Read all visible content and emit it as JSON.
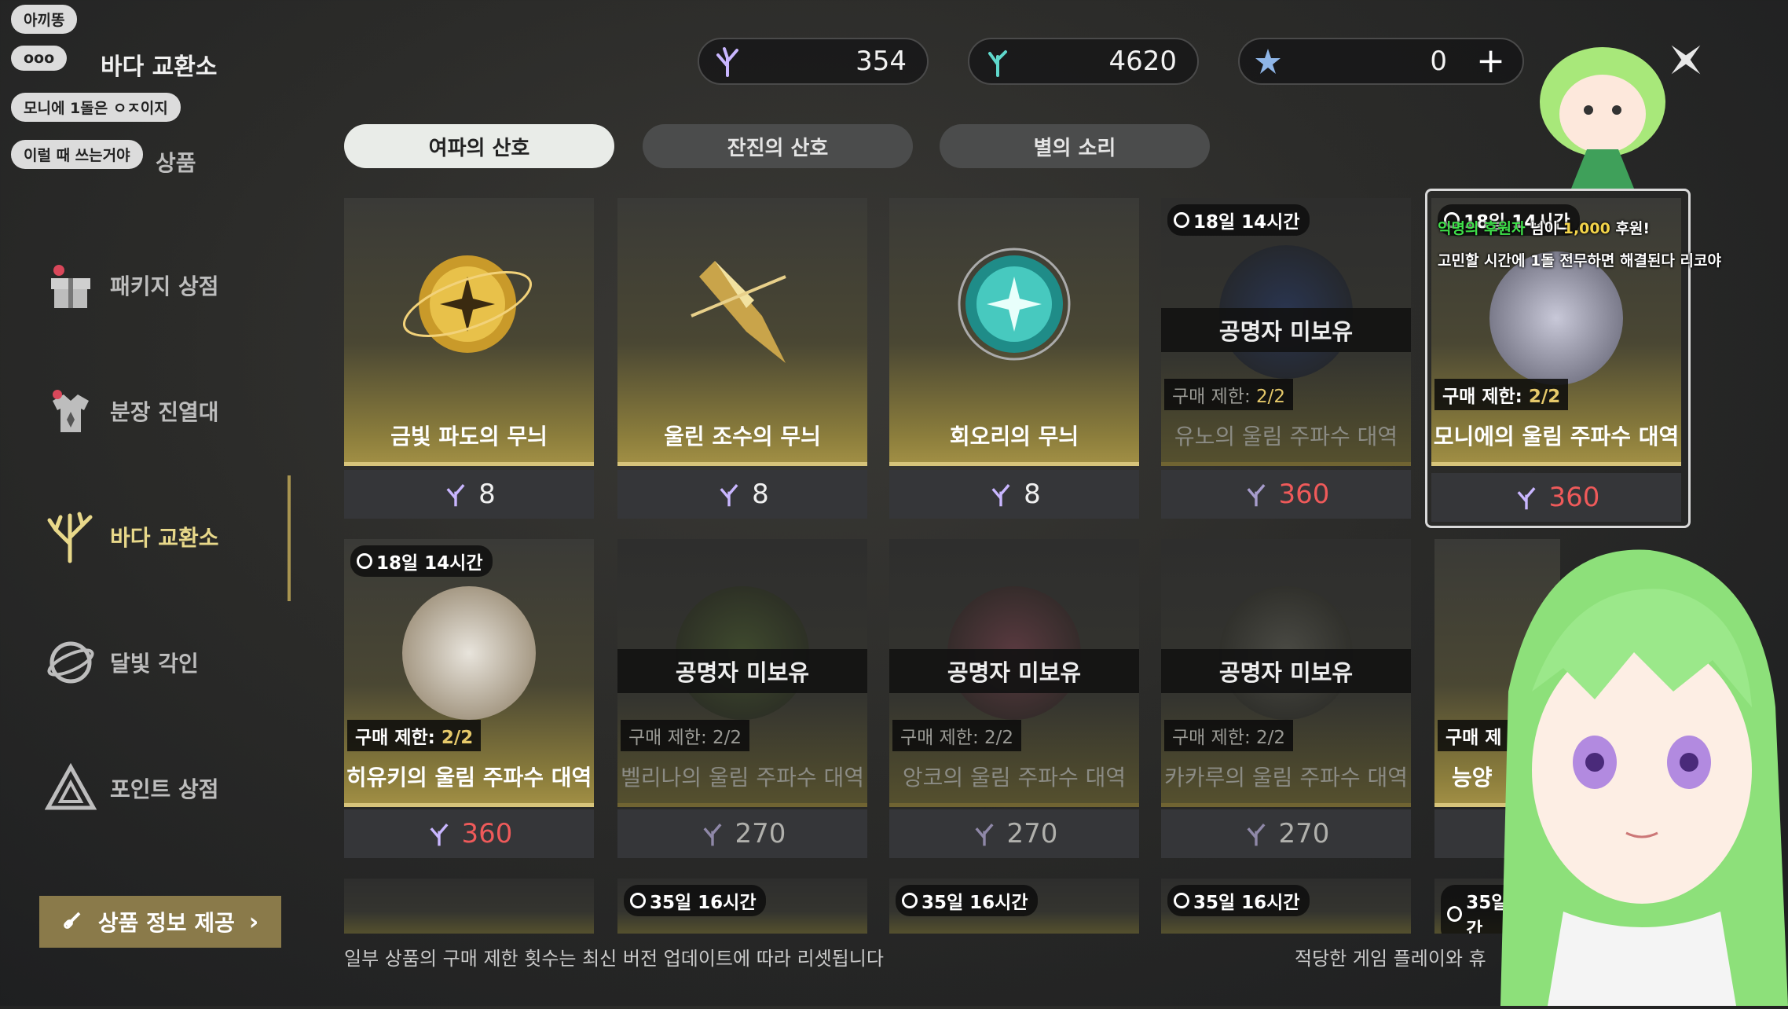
{
  "chat": {
    "bubble1": "아끼똥",
    "bubble2": "ooo",
    "bubble3": "모니에 1돌은 ㅇㅈ이지",
    "bubble4": "이럴 때 쓰는거야"
  },
  "sidebar": {
    "title": "바다 교환소",
    "partial_item": "상품",
    "items": [
      {
        "label": "패키지 상점",
        "icon": "gift-icon"
      },
      {
        "label": "분장 진열대",
        "icon": "outfit-icon"
      },
      {
        "label": "바다 교환소",
        "icon": "coral-icon",
        "active": true
      },
      {
        "label": "달빛 각인",
        "icon": "moon-icon"
      },
      {
        "label": "포인트 상점",
        "icon": "triangle-icon"
      }
    ],
    "info_button": "상품 정보 제공"
  },
  "currencies": [
    {
      "icon": "coral-currency-icon",
      "value": "354"
    },
    {
      "icon": "teal-coral-currency-icon",
      "value": "4620"
    },
    {
      "icon": "star-currency-icon",
      "value": "0"
    }
  ],
  "tabs": [
    "여파의 산호",
    "잔진의 산호",
    "별의 소리"
  ],
  "row1": [
    {
      "name": "금빛 파도의 무늬",
      "price": "8"
    },
    {
      "name": "울린 조수의 무늬",
      "price": "8"
    },
    {
      "name": "회오리의 무늬",
      "price": "8"
    },
    {
      "name": "유노의 울림 주파수 대역",
      "price": "360",
      "timer": "18일 14시간",
      "not_owned": "공명자 미보유",
      "limit_label": "구매 제한:",
      "limit_value": "2/2"
    },
    {
      "name": "모니에의 울림 주파수 대역",
      "price": "360",
      "timer": "18일 14시간",
      "limit_label": "구매 제한:",
      "limit_value": "2/2"
    }
  ],
  "row2": [
    {
      "name": "히유키의 울림 주파수 대역",
      "price": "360",
      "timer": "18일 14시간",
      "limit_label": "구매 제한:",
      "limit_value": "2/2"
    },
    {
      "name": "벨리나의 울림 주파수 대역",
      "price": "270",
      "not_owned": "공명자 미보유",
      "limit_label": "구매 제한:",
      "limit_value": "2/2"
    },
    {
      "name": "앙코의 울림 주파수 대역",
      "price": "270",
      "not_owned": "공명자 미보유",
      "limit_label": "구매 제한:",
      "limit_value": "2/2"
    },
    {
      "name": "카카루의 울림 주파수 대역",
      "price": "270",
      "not_owned": "공명자 미보유",
      "limit_label": "구매 제한:",
      "limit_value": "2/2"
    },
    {
      "name": "능양",
      "limit_label": "구매 제",
      "price": ""
    }
  ],
  "row3_timers": [
    "35일 16시간",
    "35일 16시간",
    "35일 16시간",
    "35일 16시간"
  ],
  "notice": "일부 상품의 구매 제한 횟수는 최신 버전 업데이트에 따라 리셋됩니다",
  "notice_right": "적당한 게임 플레이와 휴",
  "donation": {
    "donor": "익명의 후원자",
    "suffix": "님이",
    "amount": "1,000",
    "amount_suffix": "후원!",
    "message": "고민할 시간에 1돌 전무하면 해결된다 리코야"
  },
  "colors": {
    "accent_gold": "#d7c47a",
    "price_red": "#ef5a5a",
    "donor_green": "#3fe14a"
  }
}
